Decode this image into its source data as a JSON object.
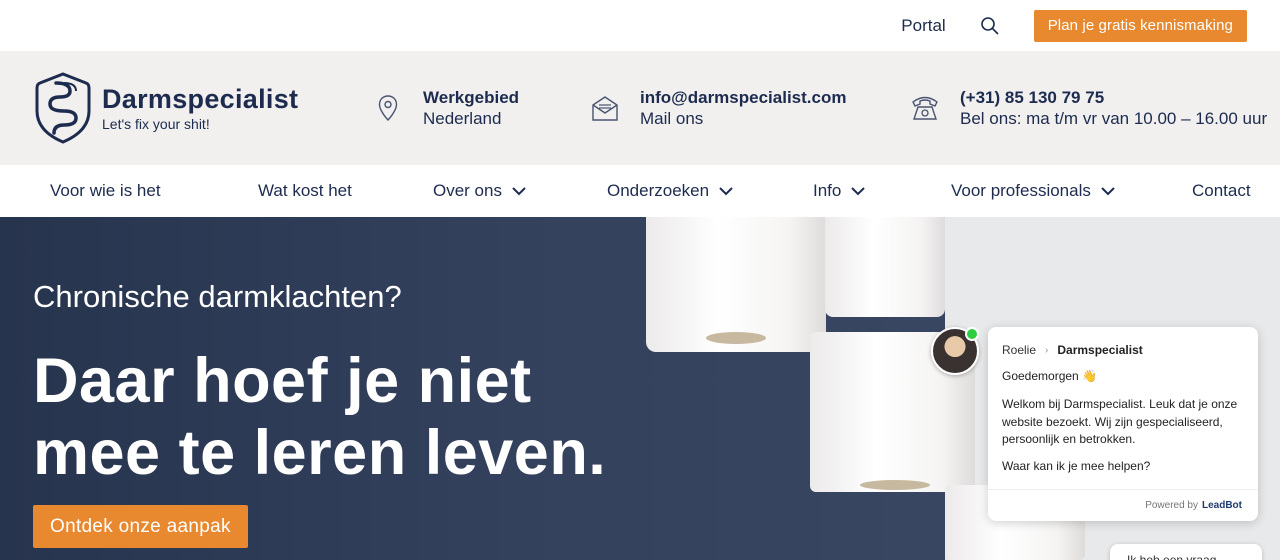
{
  "topbar": {
    "portal_label": "Portal",
    "search_icon": "search-icon",
    "cta_label": "Plan je gratis kennismaking"
  },
  "logo": {
    "name": "Darmspecialist",
    "tagline": "Let's fix your shit!"
  },
  "contact": {
    "area": {
      "icon": "location-pin-icon",
      "title": "Werkgebied",
      "value": "Nederland"
    },
    "mail": {
      "icon": "envelope-icon",
      "title": "info@darmspecialist.com",
      "value": "Mail ons"
    },
    "phone": {
      "icon": "phone-icon",
      "title": "(+31) 85 130 79 75",
      "value": "Bel ons: ma t/m vr van 10.00 – 16.00 uur"
    }
  },
  "nav": {
    "items": [
      {
        "label": "Voor wie is het",
        "dropdown": false
      },
      {
        "label": "Wat kost het",
        "dropdown": false
      },
      {
        "label": "Over ons",
        "dropdown": true
      },
      {
        "label": "Onderzoeken",
        "dropdown": true
      },
      {
        "label": "Info",
        "dropdown": true
      },
      {
        "label": "Voor professionals",
        "dropdown": true
      },
      {
        "label": "Contact",
        "dropdown": false
      }
    ]
  },
  "hero": {
    "subtitle": "Chronische darmklachten?",
    "title_line1": "Daar hoef je niet",
    "title_line2": "mee te leren leven.",
    "button_label": "Ontdek onze aanpak"
  },
  "chat": {
    "agent_name": "Roelie",
    "company": "Darmspecialist",
    "greeting": "Goedemorgen 👋",
    "message": "Welkom bij Darmspecialist. Leuk dat je onze website bezoekt. Wij zijn gespecialiseerd, persoonlijk en betrokken.",
    "question": "Waar kan ik je mee helpen?",
    "powered_by": "Powered by",
    "powered_brand": "LeadBot",
    "input_placeholder": "Ik heb een vraag",
    "online_color": "#2ecc40"
  },
  "colors": {
    "brand_navy": "#1d2b4f",
    "accent_orange": "#e8882f",
    "hero_bg": "#394661"
  }
}
